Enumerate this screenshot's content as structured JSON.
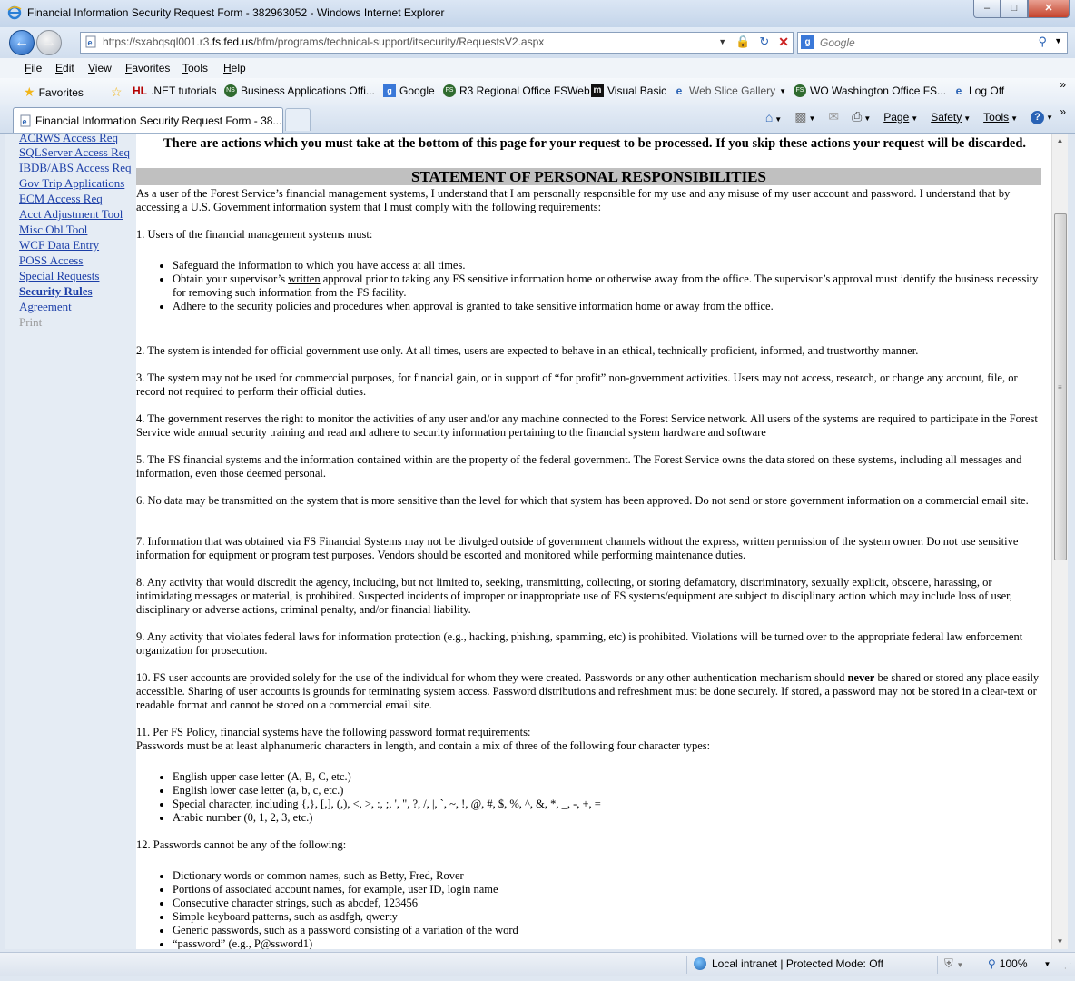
{
  "window": {
    "title": "Financial Information Security Request Form - 382963052 - Windows Internet Explorer"
  },
  "address": {
    "url_pre": "https://sxabqsql001.r3.",
    "url_host": "fs.fed.us",
    "url_post": "/bfm/programs/technical-support/itsecurity/RequestsV2.aspx"
  },
  "search": {
    "placeholder": "Google"
  },
  "menu": [
    "File",
    "Edit",
    "View",
    "Favorites",
    "Tools",
    "Help"
  ],
  "favorites": {
    "label": "Favorites",
    "items": [
      ".NET tutorials",
      "Business Applications Offi...",
      "Google",
      "R3 Regional Office FSWeb",
      "Visual Basic",
      "Web Slice Gallery",
      "WO Washington Office FS...",
      "Log Off"
    ]
  },
  "tab": {
    "label": "Financial Information Security Request Form - 38..."
  },
  "commandbar": {
    "page": "Page",
    "safety": "Safety",
    "tools": "Tools"
  },
  "sidebar": {
    "items": [
      "ACRWS Access Req",
      "SQLServer Access Req",
      "IBDB/ABS Access Req",
      "Gov Trip Applications",
      "ECM Access Req",
      "Acct Adjustment Tool",
      "Misc Obl Tool",
      "WCF Data Entry",
      "POSS Access",
      "Special Requests",
      "Security Rules",
      "Agreement"
    ],
    "current": "Security Rules",
    "print": "Print"
  },
  "content": {
    "warning": "There are actions which you must take at the bottom of this page for your request to be processed. If you skip these actions your request will be discarded.",
    "heading": "STATEMENT OF PERSONAL RESPONSIBILITIES",
    "intro": "As a user of the Forest Service’s financial management systems, I understand that I am personally responsible for my use and any misuse of my user account and password. I understand that by accessing a U.S. Government information system that I must comply with the following requirements:",
    "p1": "1. Users of the financial management systems must:",
    "p1_b1": "Safeguard the information to which you have access at all times.",
    "p1_b2_pre": "Obtain your supervisor’s ",
    "p1_b2_u": "written",
    "p1_b2_post": " approval prior to taking any FS sensitive information home or otherwise away from the office. The supervisor’s approval must identify the business necessity for removing such information from the FS facility.",
    "p1_b3": "Adhere to the security policies and procedures when approval is granted to take sensitive information home or away from the office.",
    "p2": "2. The system is intended for official government use only. At all times, users are expected to behave in an ethical, technically proficient, informed, and trustworthy manner.",
    "p3": "3. The system may not be used for commercial purposes, for financial gain, or in support of “for profit” non-government activities. Users may not access, research, or change any account, file, or record not required to perform their official duties.",
    "p4": "4. The government reserves the right to monitor the activities of any user and/or any machine connected to the Forest Service network. All users of the systems are required to participate in the Forest Service wide annual security training and read and adhere to security information pertaining to the financial system hardware and software",
    "p5": "5. The FS financial systems and the information contained within are the property of the federal government. The Forest Service owns the data stored on these systems, including all messages and information, even those deemed personal.",
    "p6": "6. No data may be transmitted on the system that is more sensitive than the level for which that system has been approved. Do not send or store government information on a commercial email site.",
    "p7": "7. Information that was obtained via FS Financial Systems may not be divulged outside of government channels without the express, written permission of the system owner. Do not use sensitive information for equipment or program test purposes.  Vendors should be escorted and monitored while performing maintenance duties.",
    "p8": "8. Any activity that would discredit the agency, including, but not limited to, seeking, transmitting, collecting, or storing defamatory, discriminatory, sexually explicit, obscene, harassing, or intimidating messages or material, is prohibited. Suspected incidents of improper or inappropriate use of FS systems/equipment are subject to disciplinary action which may include loss of user, disciplinary or adverse actions, criminal penalty, and/or financial liability.",
    "p9": "9. Any activity that violates federal laws for information protection (e.g., hacking, phishing, spamming, etc) is prohibited. Violations will be turned over to the appropriate federal law enforcement organization for prosecution.",
    "p10_pre": "10. FS user accounts are provided solely for the use of the individual for whom they were created. Passwords or any other authentication mechanism should ",
    "p10_bold": "never",
    "p10_post": " be shared or stored any place easily accessible. Sharing of user accounts is grounds for terminating system access. Password distributions and refreshment must be done securely. If stored, a password may not be stored in a clear-text or readable format and cannot be stored on a commercial email site.",
    "p11a": "11. Per FS Policy, financial systems have the following password format requirements:",
    "p11b": "Passwords must be at least alphanumeric characters in length, and contain a mix of three of the following four character types:",
    "p11_items": [
      "English upper case letter (A, B, C, etc.)",
      "English lower case letter (a, b, c, etc.)",
      "Special character, including {,}, [,], (,), <, >, :, ;, ', \", ?, /, |, `, ~, !, @, #, $, %, ^, &, *, _, -, +, =",
      "Arabic number (0, 1, 2, 3, etc.)"
    ],
    "p12": "12. Passwords cannot be any of the following:",
    "p12_items": [
      "Dictionary words or common names, such as Betty, Fred, Rover",
      "Portions of associated account names, for example, user ID, login name",
      "Consecutive character strings, such as abcdef, 123456",
      "Simple keyboard patterns, such as asdfgh, qwerty",
      "Generic passwords, such as a password consisting of a variation of the word",
      "“password” (e.g., P@ssword1)"
    ]
  },
  "status": {
    "zone": "Local intranet | Protected Mode: Off",
    "zoom": "100%"
  }
}
